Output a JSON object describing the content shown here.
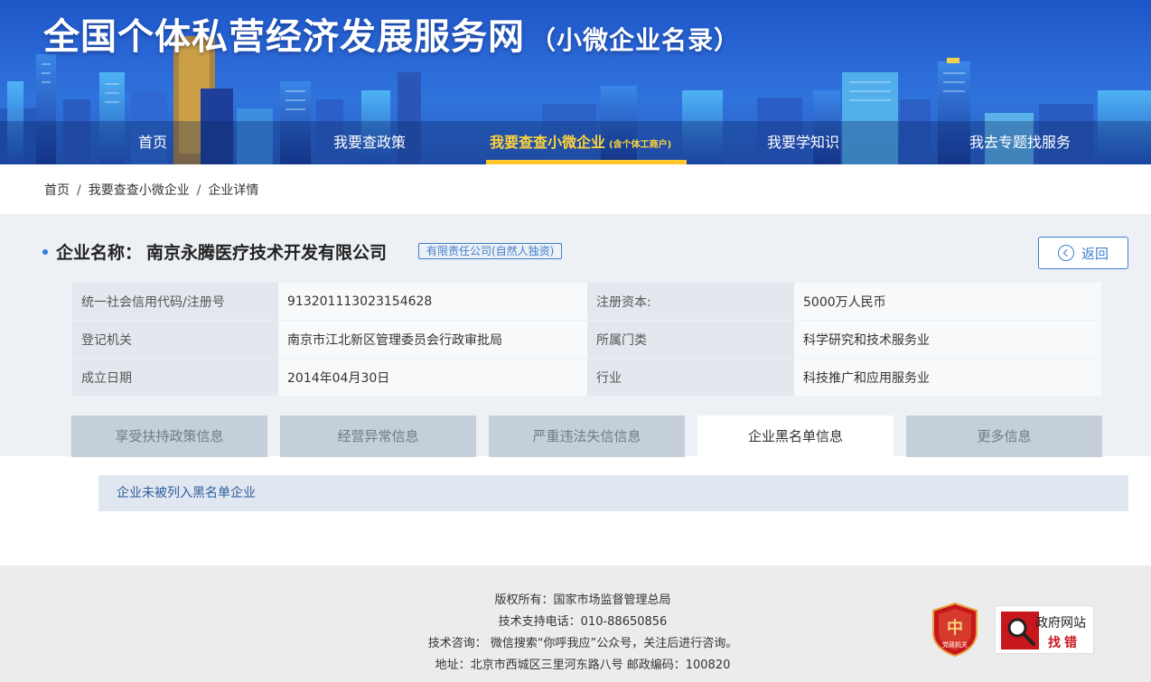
{
  "header": {
    "site_title": "全国个体私营经济发展服务网",
    "site_subtitle": "（小微企业名录）"
  },
  "nav": {
    "items": [
      {
        "label": "首页"
      },
      {
        "label": "我要查政策"
      },
      {
        "label": "我要查查小微企业",
        "sub": "(含个体工商户)",
        "active": true
      },
      {
        "label": "我要学知识"
      },
      {
        "label": "我去专题找服务"
      }
    ]
  },
  "breadcrumb": {
    "items": [
      "首页",
      "我要查查小微企业",
      "企业详情"
    ],
    "separator": "/"
  },
  "company": {
    "name_label": "企业名称：",
    "name": "南京永腾医疗技术开发有限公司",
    "type_badge": "有限责任公司(自然人独资)",
    "back_label": "返回",
    "rows": [
      {
        "k1": "统一社会信用代码/注册号",
        "v1": "913201113023154628",
        "k2": "注册资本:",
        "v2": "5000万人民币"
      },
      {
        "k1": "登记机关",
        "v1": "南京市江北新区管理委员会行政审批局",
        "k2": "所属门类",
        "v2": "科学研究和技术服务业"
      },
      {
        "k1": "成立日期",
        "v1": "2014年04月30日",
        "k2": "行业",
        "v2": "科技推广和应用服务业"
      }
    ]
  },
  "tabs": {
    "items": [
      "享受扶持政策信息",
      "经营异常信息",
      "严重违法失信信息",
      "企业黑名单信息",
      "更多信息"
    ],
    "active_index": 3
  },
  "notice": {
    "text": "企业未被列入黑名单企业"
  },
  "footer": {
    "copyright": "版权所有：国家市场监督管理总局",
    "support_phone": "技术支持电话：010-88650856",
    "consult": "技术咨询： 微信搜索“你呼我应”公众号，关注后进行咨询。",
    "address": "地址：北京市西城区三里河东路八号 邮政编码：100820",
    "gov_badge_text": "党政机关",
    "find_error_title": "政府网站",
    "find_error_sub": "找错"
  },
  "colors": {
    "header_blue": "#2a67d6",
    "active_nav": "#ffd43b",
    "accent_blue": "#3e7fd0",
    "badge_red": "#c8161d"
  }
}
